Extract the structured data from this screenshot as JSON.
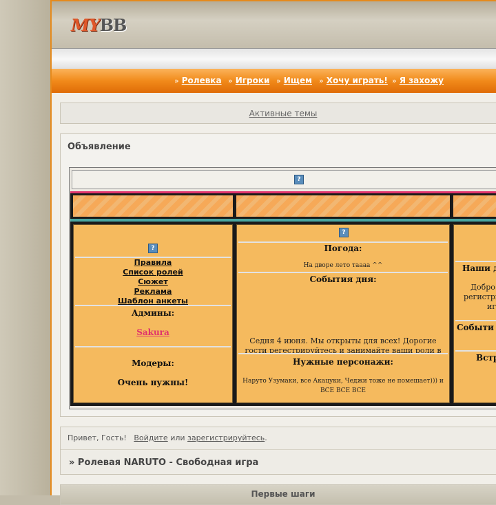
{
  "header": {
    "logo_my": "MY",
    "logo_bb": "BB"
  },
  "nav": {
    "arrow": "»",
    "items": [
      {
        "label": "Ролевка"
      },
      {
        "label": "Игроки"
      },
      {
        "label": "Ищем"
      },
      {
        "label": "Хочу играть!"
      },
      {
        "label": "Я захожу"
      }
    ]
  },
  "active_topics": "Активные темы",
  "announcement": {
    "title": "Объявление",
    "qmark": "?",
    "left_col": {
      "links": [
        "Правила",
        "Список ролей",
        "Сюжет",
        "Реклама",
        "Шаблон анкеты"
      ],
      "admins_label": "Админы:",
      "admin_name": "Sakura",
      "mods_label": "Модеры:",
      "mods_value": "Очень нужны!"
    },
    "mid_col": {
      "weather_label": "Погода:",
      "weather_text": "На дворе лето таааа ^^",
      "events_label": "События дня:",
      "events_line1": "Седня 4 июня. Мы открыты для всех! Дорогие",
      "events_line2": "гости регестрируйтесь и занимайте ваши роли в",
      "needed_label": "Нужные персонажи:",
      "needed_text": "Наруто Узумаки, все Акацуки, Чеджи тоже не помешает))) и ВСЕ ВСЕ ВСЕ"
    },
    "right_col": {
      "title_partial": "Наши де",
      "line1": "Добро",
      "line2": "регистри",
      "line3": "иг",
      "events_partial": "Событи",
      "meet_partial": "Встр"
    }
  },
  "greeting": {
    "hello": "Привет, Гость!",
    "login": "Войдите",
    "or": "или",
    "register": "зарегистрируйтесь",
    "dot": "."
  },
  "forum_title": "» Ролевая NARUTO - Свободная игра",
  "bottom_section": "Первые шаги"
}
